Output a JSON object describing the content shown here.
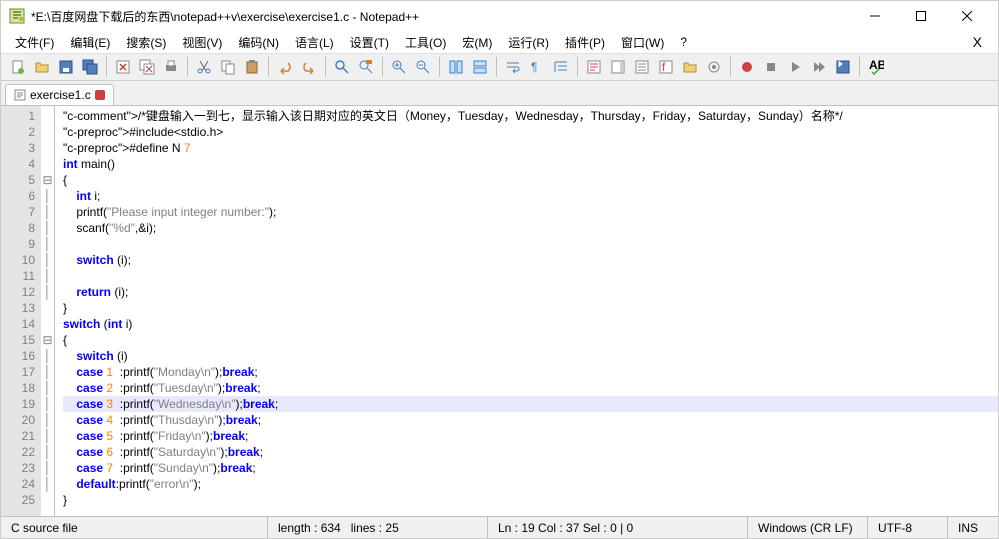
{
  "window": {
    "title": "*E:\\百度网盘下载后的东西\\notepad++v\\exercise\\exercise1.c - Notepad++"
  },
  "menu": {
    "file": "文件(F)",
    "edit": "编辑(E)",
    "search": "搜索(S)",
    "view": "视图(V)",
    "encoding": "编码(N)",
    "language": "语言(L)",
    "settings": "设置(T)",
    "tools": "工具(O)",
    "macro": "宏(M)",
    "run": "运行(R)",
    "plugins": "插件(P)",
    "window": "窗口(W)",
    "help": "?"
  },
  "tab": {
    "name": "exercise1.c"
  },
  "code": {
    "lines": [
      "/*键盘输入一到七，显示输入该日期对应的英文日（Money，Tuesday，Wednesday，Thursday，Friday，Saturday，Sunday）名称*/",
      "#include<stdio.h>",
      "#define N 7",
      "int main()",
      "{",
      "    int i;",
      "    printf(\"Please input integer number:\");",
      "    scanf(\"%d\",&i);",
      "",
      "    switch (i);",
      "",
      "    return (i);",
      "}",
      "switch (int i)",
      "{",
      "    switch (i)",
      "    case 1  :printf(\"Monday\\n\");break;",
      "    case 2  :printf(\"Tuesday\\n\");break;",
      "    case 3  :printf(\"Wednesday\\n\");break;",
      "    case 4  :printf(\"Thusday\\n\");break;",
      "    case 5  :printf(\"Friday\\n\");break;",
      "    case 6  :printf(\"Saturday\\n\");break;",
      "    case 7  :printf(\"Sunday\\n\");break;",
      "    default:printf(\"error\\n\");",
      "}"
    ],
    "highlight_line": 19
  },
  "status": {
    "filetype": "C source file",
    "length": "length : 634",
    "lines": "lines : 25",
    "pos": "Ln : 19   Col : 37   Sel : 0 | 0",
    "eol": "Windows (CR LF)",
    "encoding": "UTF-8",
    "mode": "INS"
  }
}
